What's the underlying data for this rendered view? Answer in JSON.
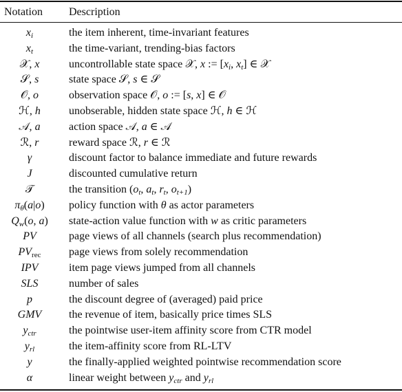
{
  "table": {
    "headers": {
      "notation": "Notation",
      "description": "Description"
    },
    "rows": [
      {
        "notation": [
          [
            "x",
            "i"
          ],
          [
            "i",
            "s"
          ]
        ],
        "description": [
          [
            "the item inherent, time-invariant features",
            ""
          ]
        ]
      },
      {
        "notation": [
          [
            "x",
            "i"
          ],
          [
            "t",
            "s"
          ]
        ],
        "description": [
          [
            "the time-variant, trending-bias factors",
            ""
          ]
        ]
      },
      {
        "notation": [
          [
            "𝒳, ",
            ""
          ],
          [
            "x",
            "i"
          ]
        ],
        "description": [
          [
            "uncontrollable state space 𝒳, ",
            ""
          ],
          [
            "x",
            "i"
          ],
          [
            " := [",
            ""
          ],
          [
            "x",
            "i"
          ],
          [
            "i",
            "s"
          ],
          [
            ", ",
            ""
          ],
          [
            "x",
            "i"
          ],
          [
            "t",
            "s"
          ],
          [
            "] ∈ 𝒳",
            ""
          ]
        ]
      },
      {
        "notation": [
          [
            "𝒮, ",
            ""
          ],
          [
            "s",
            "i"
          ]
        ],
        "description": [
          [
            "state space 𝒮, ",
            ""
          ],
          [
            "s",
            "i"
          ],
          [
            " ∈ 𝒮",
            ""
          ]
        ]
      },
      {
        "notation": [
          [
            "𝒪, ",
            ""
          ],
          [
            "o",
            "i"
          ]
        ],
        "description": [
          [
            "observation space 𝒪, ",
            ""
          ],
          [
            "o",
            "i"
          ],
          [
            " := [",
            ""
          ],
          [
            "s",
            "i"
          ],
          [
            ", ",
            ""
          ],
          [
            "x",
            "i"
          ],
          [
            "] ∈ 𝒪",
            ""
          ]
        ]
      },
      {
        "notation": [
          [
            "ℋ, ",
            ""
          ],
          [
            "h",
            "i"
          ]
        ],
        "description": [
          [
            "unobserable, hidden state space ℋ, ",
            ""
          ],
          [
            "h",
            "i"
          ],
          [
            " ∈ ℋ",
            ""
          ]
        ]
      },
      {
        "notation": [
          [
            "𝒜, ",
            ""
          ],
          [
            "a",
            "i"
          ]
        ],
        "description": [
          [
            "action space 𝒜, ",
            ""
          ],
          [
            "a",
            "i"
          ],
          [
            " ∈ 𝒜",
            ""
          ]
        ]
      },
      {
        "notation": [
          [
            "ℛ, ",
            ""
          ],
          [
            "r",
            "i"
          ]
        ],
        "description": [
          [
            "reward space ℛ, ",
            ""
          ],
          [
            "r",
            "i"
          ],
          [
            " ∈ ℛ",
            ""
          ]
        ]
      },
      {
        "notation": [
          [
            "γ",
            "i"
          ]
        ],
        "description": [
          [
            "discount factor to balance immediate and future rewards",
            ""
          ]
        ]
      },
      {
        "notation": [
          [
            "J",
            "i"
          ]
        ],
        "description": [
          [
            "discounted cumulative return",
            ""
          ]
        ]
      },
      {
        "notation": [
          [
            "𝒯",
            ""
          ]
        ],
        "description": [
          [
            "the transition (",
            ""
          ],
          [
            "o",
            "i"
          ],
          [
            "t",
            "s"
          ],
          [
            ", ",
            ""
          ],
          [
            "a",
            "i"
          ],
          [
            "t",
            "s"
          ],
          [
            ", ",
            ""
          ],
          [
            "r",
            "i"
          ],
          [
            "t",
            "s"
          ],
          [
            ", ",
            ""
          ],
          [
            "o",
            "i"
          ],
          [
            "t+1",
            "s"
          ],
          [
            ")",
            ""
          ]
        ]
      },
      {
        "notation": [
          [
            "π",
            "i"
          ],
          [
            "θ",
            "s"
          ],
          [
            "(",
            ""
          ],
          [
            "a",
            "i"
          ],
          [
            "|",
            ""
          ],
          [
            "o",
            "i"
          ],
          [
            ")",
            ""
          ]
        ],
        "description": [
          [
            "policy function with ",
            ""
          ],
          [
            "θ",
            "i"
          ],
          [
            " as actor parameters",
            ""
          ]
        ]
      },
      {
        "notation": [
          [
            "Q",
            "i"
          ],
          [
            "w",
            "s"
          ],
          [
            "(",
            ""
          ],
          [
            "o",
            "i"
          ],
          [
            ", ",
            ""
          ],
          [
            "a",
            "i"
          ],
          [
            ")",
            ""
          ]
        ],
        "description": [
          [
            "state-action value function with ",
            ""
          ],
          [
            "w",
            "i"
          ],
          [
            " as critic parameters",
            ""
          ]
        ]
      },
      {
        "notation": [
          [
            "PV",
            "i"
          ]
        ],
        "description": [
          [
            "page views of all channels (search plus recommendation)",
            ""
          ]
        ]
      },
      {
        "notation": [
          [
            "PV",
            "i"
          ],
          [
            "rec",
            "sr"
          ]
        ],
        "description": [
          [
            "page views from solely recommendation",
            ""
          ]
        ]
      },
      {
        "notation": [
          [
            "IPV",
            "i"
          ]
        ],
        "description": [
          [
            "item page views jumped from all channels",
            ""
          ]
        ]
      },
      {
        "notation": [
          [
            "SLS",
            "i"
          ]
        ],
        "description": [
          [
            "number of sales",
            ""
          ]
        ]
      },
      {
        "notation": [
          [
            "p",
            "i"
          ]
        ],
        "description": [
          [
            "the discount degree of (averaged) paid price",
            ""
          ]
        ]
      },
      {
        "notation": [
          [
            "GMV",
            "i"
          ]
        ],
        "description": [
          [
            "the revenue of item, basically price times SLS",
            ""
          ]
        ]
      },
      {
        "notation": [
          [
            "y",
            "i"
          ],
          [
            "ctr",
            "s"
          ]
        ],
        "description": [
          [
            "the pointwise user-item affinity score from CTR model",
            ""
          ]
        ]
      },
      {
        "notation": [
          [
            "y",
            "i"
          ],
          [
            "rl",
            "s"
          ]
        ],
        "description": [
          [
            "the item-affinity score from RL-LTV",
            ""
          ]
        ]
      },
      {
        "notation": [
          [
            "y",
            "i"
          ]
        ],
        "description": [
          [
            "the finally-applied weighted pointwise recommendation score",
            ""
          ]
        ]
      },
      {
        "notation": [
          [
            "α",
            "i"
          ]
        ],
        "description": [
          [
            "linear weight between ",
            ""
          ],
          [
            "y",
            "i"
          ],
          [
            "ctr",
            "s"
          ],
          [
            " and ",
            ""
          ],
          [
            "y",
            "i"
          ],
          [
            "rl",
            "s"
          ]
        ]
      }
    ]
  }
}
